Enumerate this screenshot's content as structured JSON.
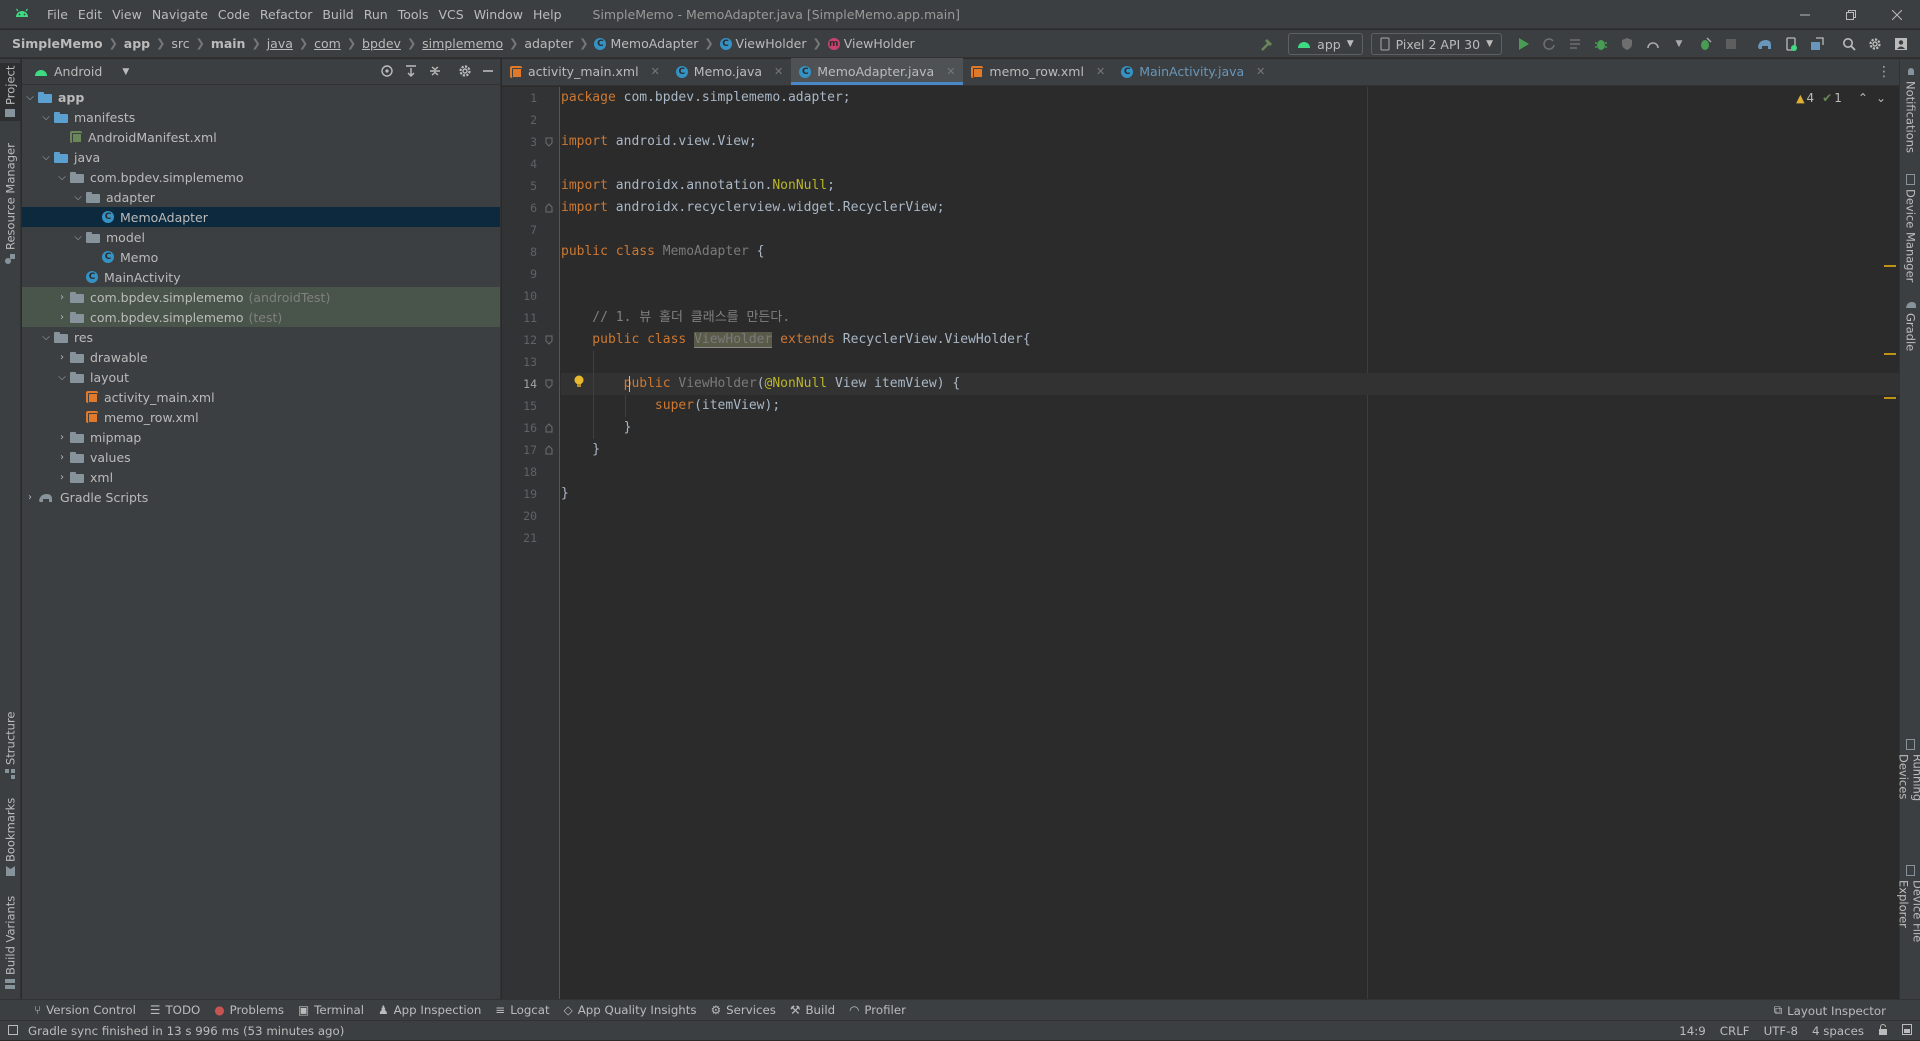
{
  "menubar": {
    "items": [
      "File",
      "Edit",
      "View",
      "Navigate",
      "Code",
      "Refactor",
      "Build",
      "Run",
      "Tools",
      "VCS",
      "Window",
      "Help"
    ],
    "title": "SimpleMemo - MemoAdapter.java [SimpleMemo.app.main]"
  },
  "breadcrumbs": [
    "SimpleMemo",
    "app",
    "src",
    "main",
    "java",
    "com",
    "bpdev",
    "simplememo",
    "adapter",
    "MemoAdapter",
    "ViewHolder",
    "ViewHolder"
  ],
  "toolbar": {
    "run_config": "app",
    "device": "Pixel 2 API 30"
  },
  "left_strip": {
    "project": "Project",
    "resource_manager": "Resource Manager",
    "structure": "Structure",
    "bookmarks": "Bookmarks",
    "build_variants": "Build Variants"
  },
  "right_strip": {
    "notifications": "Notifications",
    "device_manager": "Device Manager",
    "gradle": "Gradle",
    "running_devices": "Running Devices",
    "device_file_explorer": "Device File Explorer"
  },
  "project_panel": {
    "view": "Android"
  },
  "tree": [
    {
      "label": "app",
      "hint": ""
    },
    {
      "label": "manifests",
      "hint": ""
    },
    {
      "label": "AndroidManifest.xml",
      "hint": ""
    },
    {
      "label": "java",
      "hint": ""
    },
    {
      "label": "com.bpdev.simplememo",
      "hint": ""
    },
    {
      "label": "adapter",
      "hint": ""
    },
    {
      "label": "MemoAdapter",
      "hint": ""
    },
    {
      "label": "model",
      "hint": ""
    },
    {
      "label": "Memo",
      "hint": ""
    },
    {
      "label": "MainActivity",
      "hint": ""
    },
    {
      "label": "com.bpdev.simplememo",
      "hint": "(androidTest)"
    },
    {
      "label": "com.bpdev.simplememo",
      "hint": "(test)"
    },
    {
      "label": "res",
      "hint": ""
    },
    {
      "label": "drawable",
      "hint": ""
    },
    {
      "label": "layout",
      "hint": ""
    },
    {
      "label": "activity_main.xml",
      "hint": ""
    },
    {
      "label": "memo_row.xml",
      "hint": ""
    },
    {
      "label": "mipmap",
      "hint": ""
    },
    {
      "label": "values",
      "hint": ""
    },
    {
      "label": "xml",
      "hint": ""
    },
    {
      "label": "Gradle Scripts",
      "hint": ""
    }
  ],
  "tabs": [
    "activity_main.xml",
    "Memo.java",
    "MemoAdapter.java",
    "memo_row.xml",
    "MainActivity.java"
  ],
  "editor": {
    "line_numbers": [
      "1",
      "2",
      "3",
      "4",
      "5",
      "6",
      "7",
      "8",
      "9",
      "10",
      "11",
      "12",
      "13",
      "14",
      "15",
      "16",
      "17",
      "18",
      "19",
      "20",
      "21"
    ],
    "code": {
      "l1a": "package ",
      "l1b": "com.bpdev.simplememo.adapter;",
      "l3a": "import ",
      "l3b": "android.view.View;",
      "l5a": "import ",
      "l5b": "androidx.annotation.",
      "l5c": "NonNull",
      "l5d": ";",
      "l6a": "import ",
      "l6b": "androidx.recyclerview.widget.RecyclerView;",
      "l8a": "public class ",
      "l8b": "MemoAdapter",
      "l8c": " {",
      "l11": "    // 1. 뷰 홀더 클래스를 만든다.",
      "l12a": "    public class ",
      "l12b": "ViewHolder",
      "l12c": " extends ",
      "l12d": "RecyclerView.ViewHolder{",
      "l14a": "        public ",
      "l14b": "ViewHolder",
      "l14c": "(",
      "l14d": "@NonNull",
      "l14e": " View itemView) {",
      "l15a": "            ",
      "l15b": "super",
      "l15c": "(itemView);",
      "l16": "        }",
      "l17": "    }",
      "l20": "}"
    },
    "warnings": "4",
    "weak_warnings": "1"
  },
  "tool_windows": [
    "Version Control",
    "TODO",
    "Problems",
    "Terminal",
    "App Inspection",
    "Logcat",
    "App Quality Insights",
    "Services",
    "Build",
    "Profiler"
  ],
  "layout_inspector": "Layout Inspector",
  "status": {
    "message": "Gradle sync finished in 13 s 996 ms (53 minutes ago)",
    "position": "14:9",
    "line_sep": "CRLF",
    "encoding": "UTF-8",
    "indent": "4 spaces"
  },
  "colors": {
    "accent": "#4a88c7",
    "selection": "#0d293e",
    "keyword": "#cc7832",
    "annotation": "#bbb529",
    "android_green": "#3ddc84"
  }
}
